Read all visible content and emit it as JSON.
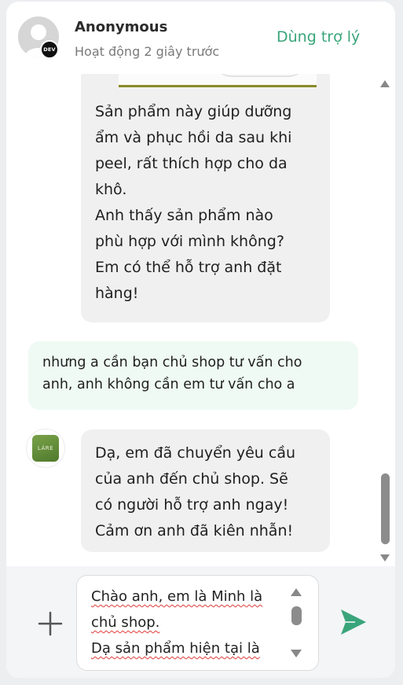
{
  "header": {
    "user_name": "Anonymous",
    "user_status": "Hoạt động 2 giây trước",
    "avatar_badge": "DEV",
    "assist_button": "Dùng trợ lý"
  },
  "messages": {
    "bot_1_lines": [
      "Sản phẩm này giúp dưỡng",
      "ẩm và phục hồi da sau khi",
      "peel, rất thích hợp cho da",
      "khô.",
      "Anh thấy sản phẩm nào",
      "phù hợp với mình không?",
      "Em có thể hỗ trợ anh đặt",
      "hàng!"
    ],
    "user_1_lines": [
      "nhưng a cần bạn chủ shop tư vấn cho",
      "anh, anh không cần em tư vấn cho a"
    ],
    "bot_2_lines": [
      "Dạ, em đã chuyển yêu cầu",
      "của anh đến chủ shop. Sẽ",
      "có người hỗ trợ anh ngay!",
      "Cảm ơn anh đã kiên nhẫn!"
    ],
    "bot_avatar_label": "LÁRE"
  },
  "composer": {
    "input_lines": [
      "Chào anh, em là Minh là",
      "chủ shop.",
      "Dạ sản phẩm hiện tại là"
    ]
  },
  "colors": {
    "accent": "#3aa57a",
    "user_bubble": "#effaf4",
    "bot_bubble": "#f0f0f0"
  },
  "icons": {
    "add": "plus-icon",
    "send": "send-icon",
    "scroll_up": "triangle-up-icon",
    "scroll_down": "triangle-down-icon"
  }
}
